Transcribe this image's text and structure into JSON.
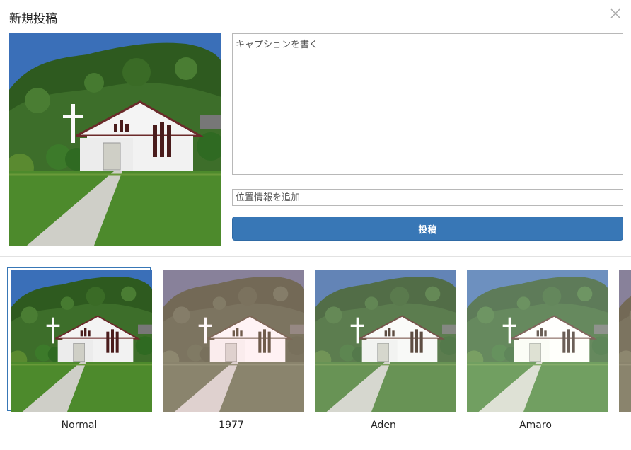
{
  "dialog": {
    "title": "新規投稿",
    "close_icon": "close-icon"
  },
  "caption": {
    "placeholder": "キャプションを書く",
    "value": ""
  },
  "location": {
    "placeholder": "位置情報を追加",
    "value": ""
  },
  "post_button": {
    "label": "投稿"
  },
  "colors": {
    "accent": "#3877b6"
  },
  "filters": [
    {
      "name": "Normal",
      "selected": true
    },
    {
      "name": "1977",
      "selected": false
    },
    {
      "name": "Aden",
      "selected": false
    },
    {
      "name": "Amaro",
      "selected": false
    }
  ]
}
